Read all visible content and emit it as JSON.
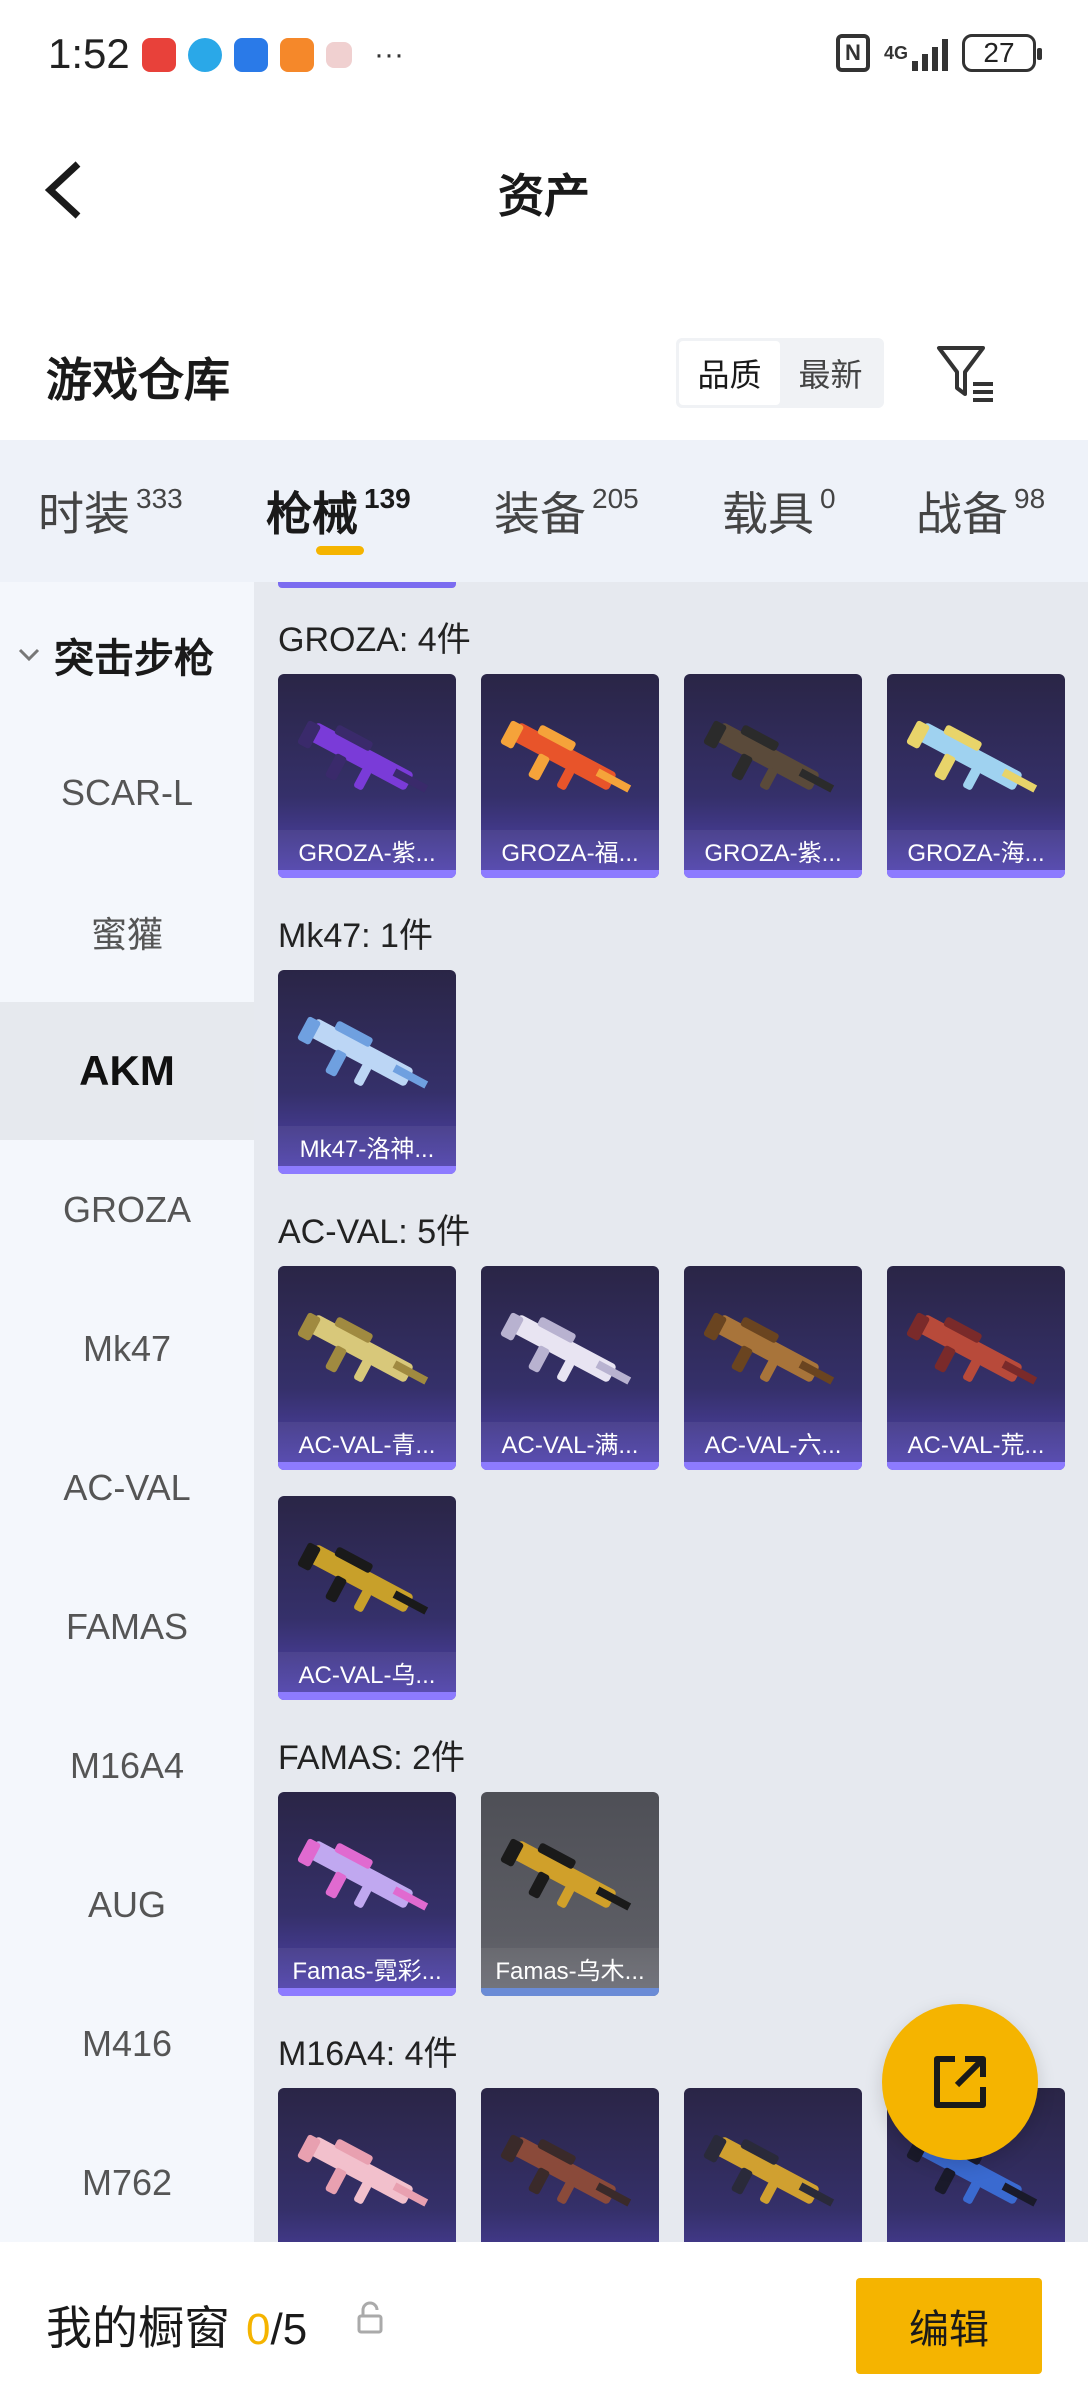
{
  "status_bar": {
    "time": "1:52",
    "network": "4G",
    "battery": "27"
  },
  "header": {
    "title": "资产"
  },
  "warehouse": {
    "title": "游戏仓库",
    "sort_options": [
      "品质",
      "最新"
    ],
    "active_sort": "品质"
  },
  "tabs": [
    {
      "label": "时装",
      "count": "333"
    },
    {
      "label": "枪械",
      "count": "139"
    },
    {
      "label": "装备",
      "count": "205"
    },
    {
      "label": "载具",
      "count": "0"
    },
    {
      "label": "战备",
      "count": "98"
    }
  ],
  "active_tab": "枪械",
  "sidebar": {
    "header": "突击步枪",
    "items": [
      "SCAR-L",
      "蜜獾",
      "AKM",
      "GROZA",
      "Mk47",
      "AC-VAL",
      "FAMAS",
      "M16A4",
      "AUG",
      "M416",
      "M762"
    ],
    "active": "AKM"
  },
  "groups": [
    {
      "title": "GROZA: 4件",
      "items": [
        {
          "label": "GROZA-紫...",
          "colors": [
            "#7a3bd8",
            "#3a2a6b"
          ]
        },
        {
          "label": "GROZA-福...",
          "colors": [
            "#e8542a",
            "#f5a33a"
          ]
        },
        {
          "label": "GROZA-紫...",
          "colors": [
            "#5a4a3a",
            "#2b2b2b"
          ]
        },
        {
          "label": "GROZA-海...",
          "colors": [
            "#9fd2f0",
            "#e8d46a"
          ]
        }
      ]
    },
    {
      "title": "Mk47: 1件",
      "items": [
        {
          "label": "Mk47-洛神...",
          "colors": [
            "#bcd6f5",
            "#6fa0e0"
          ]
        }
      ]
    },
    {
      "title": "AC-VAL: 5件",
      "items": [
        {
          "label": "AC-VAL-青...",
          "colors": [
            "#d8c87a",
            "#a08a40"
          ]
        },
        {
          "label": "AC-VAL-满...",
          "colors": [
            "#e8e4f2",
            "#b8b2d0"
          ]
        },
        {
          "label": "AC-VAL-六...",
          "colors": [
            "#a8743a",
            "#6a4420"
          ]
        },
        {
          "label": "AC-VAL-荒...",
          "colors": [
            "#b84a3a",
            "#7a2a2a"
          ]
        },
        {
          "label": "AC-VAL-乌...",
          "colors": [
            "#c8a02a",
            "#1a1a1a"
          ]
        }
      ]
    },
    {
      "title": "FAMAS: 2件",
      "items": [
        {
          "label": "Famas-霓彩...",
          "colors": [
            "#c0a8f0",
            "#e06ad0"
          ]
        },
        {
          "label": "Famas-乌木...",
          "colors": [
            "#d0a02a",
            "#1a1a1a"
          ],
          "grey": true
        }
      ]
    },
    {
      "title": "M16A4: 4件",
      "items": [
        {
          "label": "",
          "colors": [
            "#f2c0cc",
            "#e8a0b0"
          ]
        },
        {
          "label": "",
          "colors": [
            "#8a4a3a",
            "#3a2a2a"
          ]
        },
        {
          "label": "",
          "colors": [
            "#d0a030",
            "#2a2a3a"
          ]
        },
        {
          "label": "",
          "colors": [
            "#3a6ad0",
            "#1a1a2a"
          ]
        }
      ]
    }
  ],
  "bottom": {
    "label": "我的橱窗",
    "current": "0",
    "separator": "/",
    "total": "5",
    "edit_label": "编辑"
  },
  "colors": {
    "accent": "#f5b400",
    "card_purple": "#5244b2",
    "tab_bg": "#eef2f9"
  }
}
